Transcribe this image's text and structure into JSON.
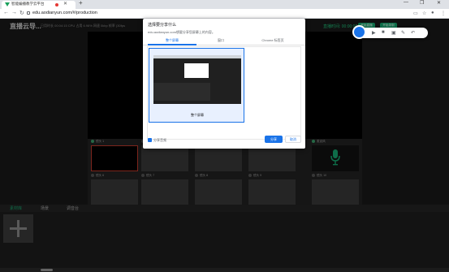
{
  "browser": {
    "tab_title": "智能编播教学云平台",
    "new_tab": "+",
    "address": "edu.aodianyun.com/#/production",
    "window_controls": [
      "—",
      "❐",
      "✕"
    ]
  },
  "app": {
    "title": "直播云导...",
    "stats": "已用时长 00:04:15 CPU 占用 6.96% 网速 0kbp 帧率 (30fps",
    "top_buttons": [
      "开始直播",
      "开始录制"
    ],
    "timer": "直播时间: 00:00:00",
    "preview_labels": [
      "麦克风 1"
    ],
    "scene_row1": [
      {
        "num": "1",
        "label": "镜头 1"
      },
      {
        "num": "2",
        "label": "镜头 2"
      },
      {
        "num": "",
        "label": ""
      },
      {
        "num": "",
        "label": ""
      },
      {
        "num": "5",
        "label": "麦克风"
      }
    ],
    "scene_row2": [
      {
        "num": "",
        "label": "镜头 6"
      },
      {
        "num": "",
        "label": "镜头 7"
      },
      {
        "num": "",
        "label": "镜头 8"
      },
      {
        "num": "",
        "label": "镜头 9"
      },
      {
        "num": "",
        "label": "镜头 10"
      }
    ],
    "action_buttons": [
      "选择镜头 ▾",
      "切换"
    ],
    "bottom_tabs": [
      "素材库",
      "场景",
      "调音台"
    ]
  },
  "dialog": {
    "title": "选择要分享什么",
    "subtitle": "edu.aodianyun.com想要分享您屏幕上的内容。",
    "tabs": [
      "整个屏幕",
      "窗口",
      "Chrome 标签页"
    ],
    "thumbnail_label": "整个屏幕",
    "share_audio_label": "分享音频",
    "share_button": "分享",
    "cancel_button": "取消"
  },
  "colors": {
    "accent": "#1a73e8",
    "brand_green": "#16a870",
    "app_bg": "#191919"
  }
}
